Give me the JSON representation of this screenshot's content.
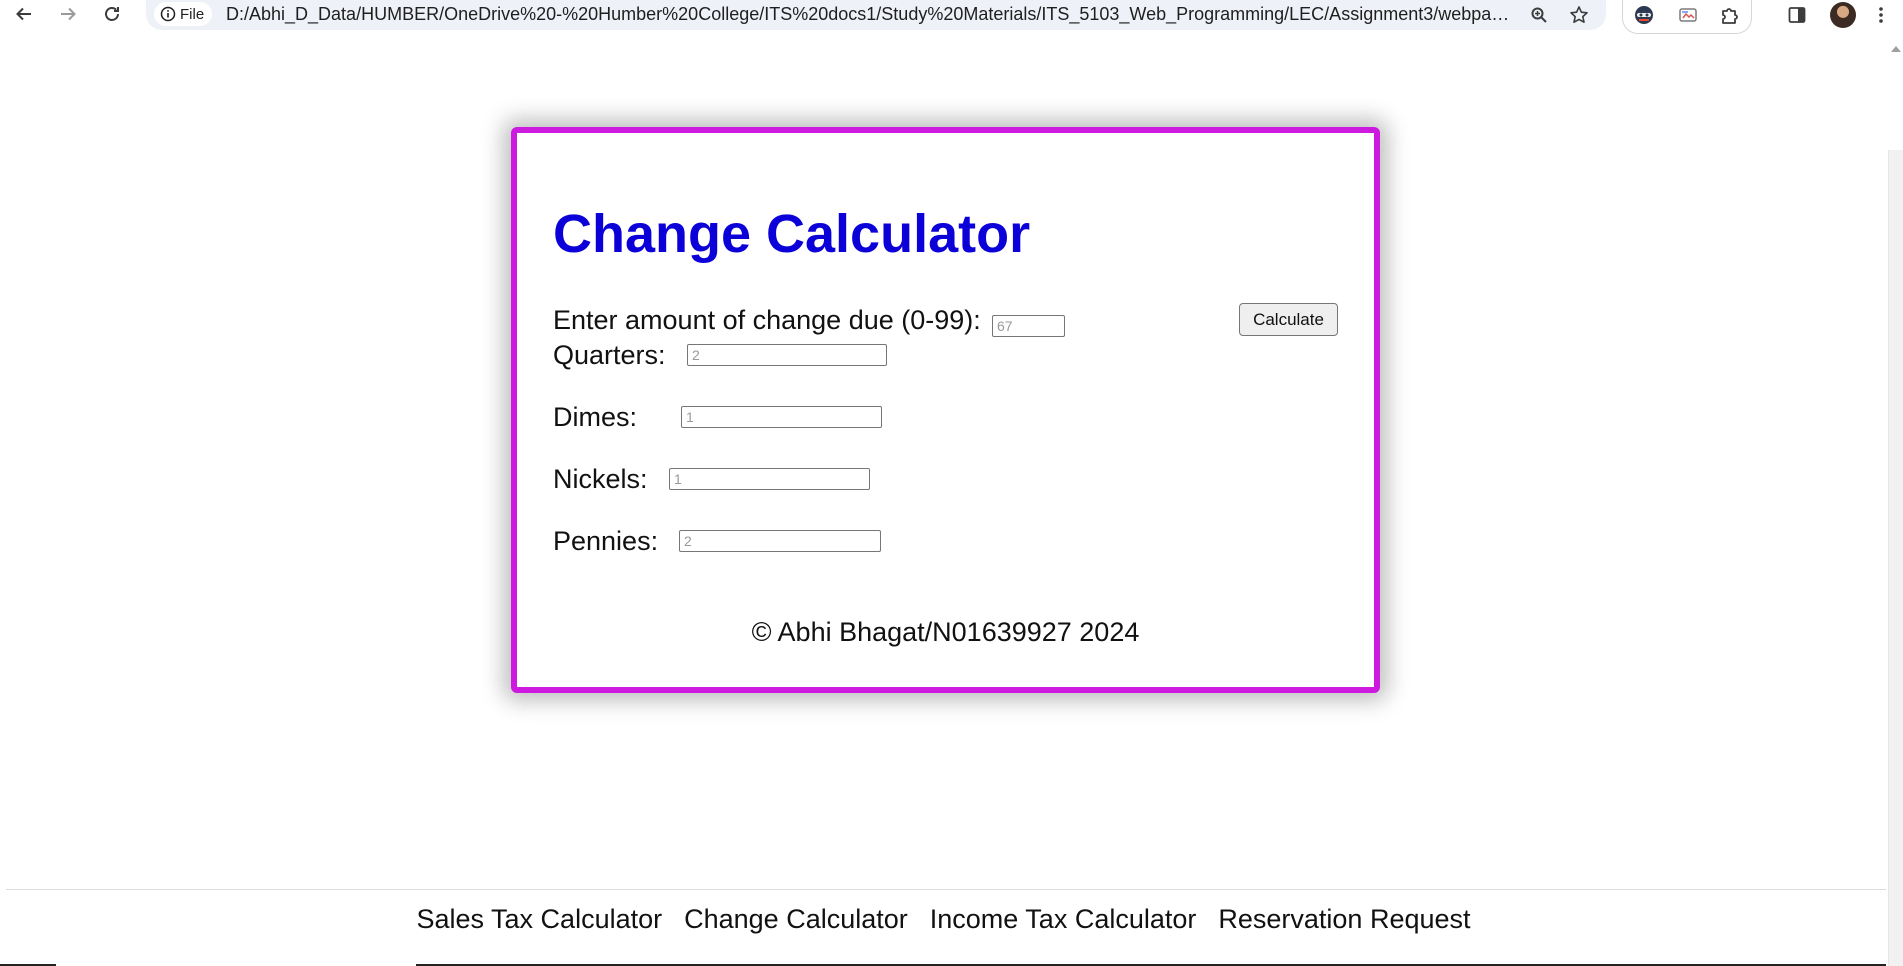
{
  "browser": {
    "site_chip_label": "File",
    "url": "D:/Abhi_D_Data/HUMBER/OneDrive%20-%20Humber%20College/ITS%20docs1/Study%20Materials/ITS_5103_Web_Programming/LEC/Assignment3/webpages/part2...."
  },
  "calculator": {
    "title": "Change Calculator",
    "amount_label": "Enter amount of change due (0-99):",
    "amount_placeholder": "67",
    "calculate_label": "Calculate",
    "quarters_label": "Quarters:",
    "quarters_placeholder": "2",
    "dimes_label": "Dimes:",
    "dimes_placeholder": "1",
    "nickels_label": "Nickels:",
    "nickels_placeholder": "1",
    "pennies_label": "Pennies:",
    "pennies_placeholder": "2",
    "copyright": "© Abhi Bhagat/N01639927 2024"
  },
  "footer": {
    "links": [
      "Sales Tax Calculator",
      "Change Calculator",
      "Income Tax Calculator",
      "Reservation Request"
    ]
  },
  "colors": {
    "title": "#0b00d8",
    "card_border": "#cc1adf"
  }
}
